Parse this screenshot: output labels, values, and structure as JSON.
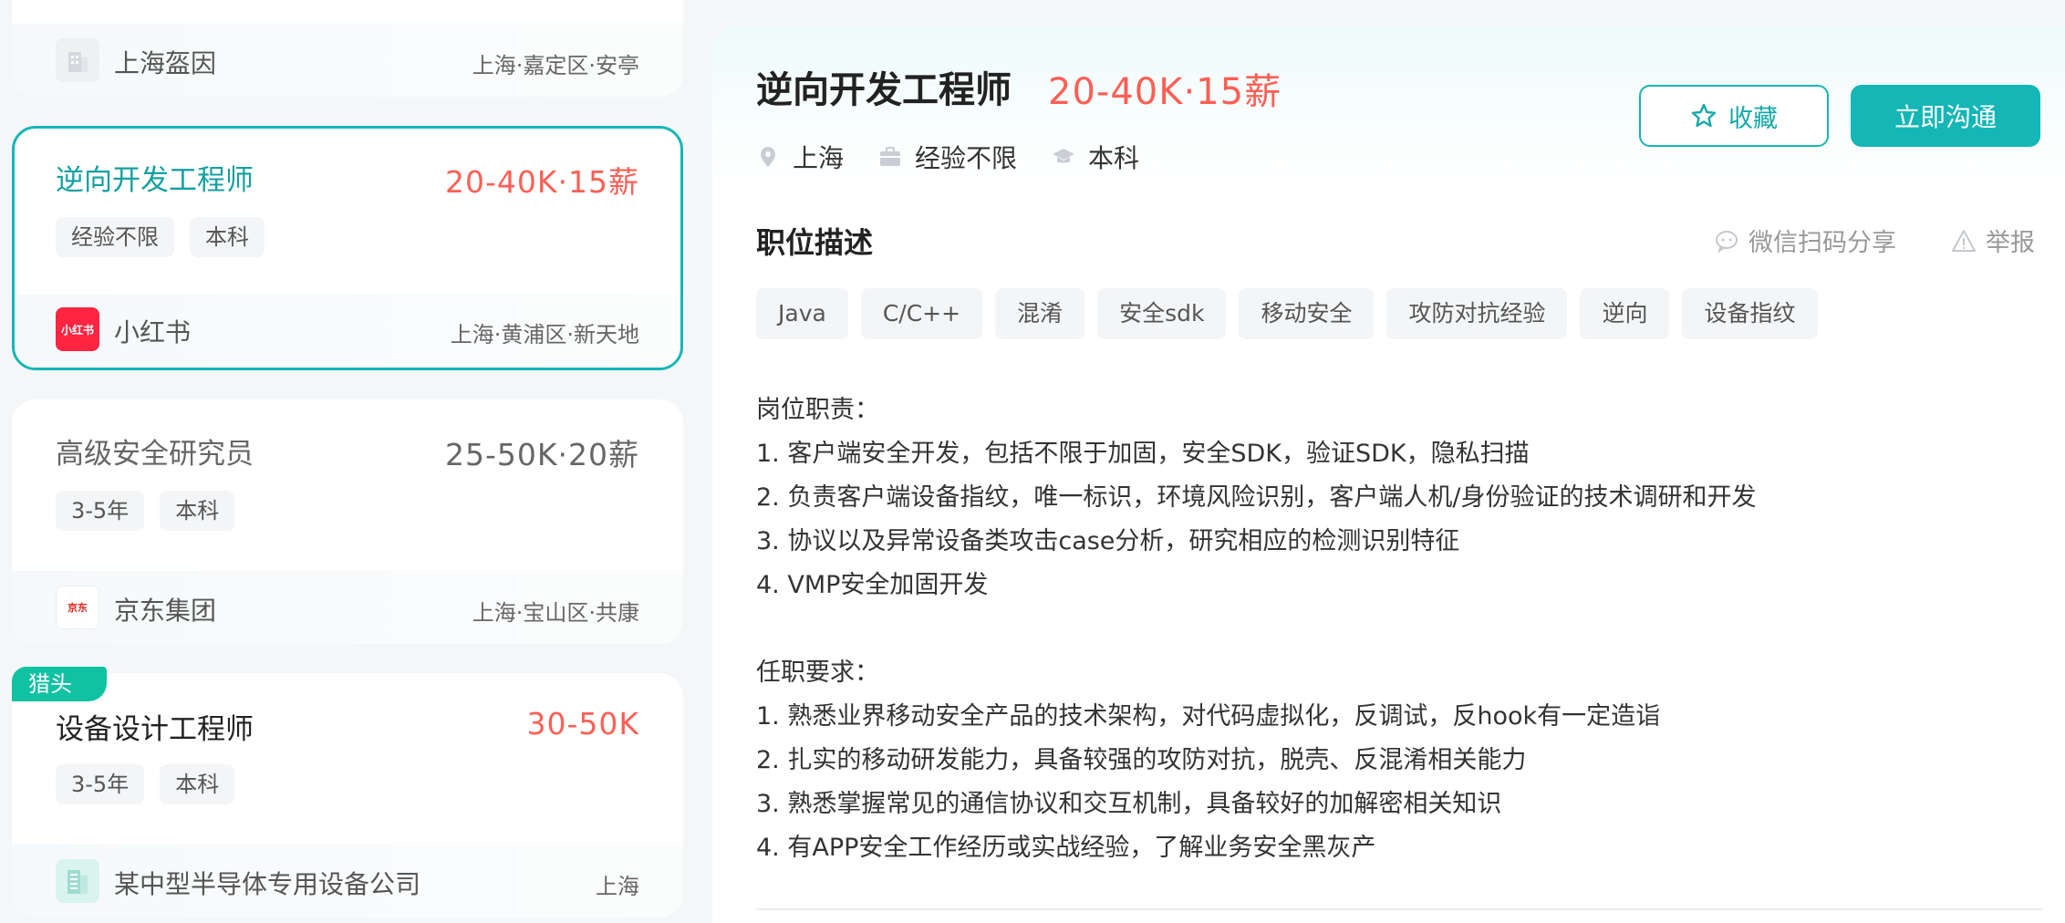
{
  "job_list": {
    "card0": {
      "company": "上海盔因",
      "location": "上海·嘉定区·安亭"
    },
    "card1": {
      "title": "逆向开发工程师",
      "salary": "20-40K·15薪",
      "tags": [
        "经验不限",
        "本科"
      ],
      "company": "小红书",
      "company_logo_text": "小红书",
      "location": "上海·黄浦区·新天地"
    },
    "card2": {
      "title": "高级安全研究员",
      "salary": "25-50K·20薪",
      "tags": [
        "3-5年",
        "本科"
      ],
      "company": "京东集团",
      "company_logo_text": "京东",
      "location": "上海·宝山区·共康"
    },
    "card3": {
      "badge": "猎头",
      "title": "设备设计工程师",
      "salary": "30-50K",
      "tags": [
        "3-5年",
        "本科"
      ],
      "company": "某中型半导体专用设备公司",
      "location": "上海"
    }
  },
  "detail": {
    "title": "逆向开发工程师",
    "salary": "20-40K·15薪",
    "meta": {
      "city": "上海",
      "experience": "经验不限",
      "degree": "本科"
    },
    "fav_label": "收藏",
    "chat_label": "立即沟通",
    "section_title": "职位描述",
    "share_label": "微信扫码分享",
    "report_label": "举报",
    "skills": [
      "Java",
      "C/C++",
      "混淆",
      "安全sdk",
      "移动安全",
      "攻防对抗经验",
      "逆向",
      "设备指纹"
    ],
    "duties_title": "岗位职责：",
    "duties": [
      "1. 客户端安全开发，包括不限于加固，安全SDK，验证SDK，隐私扫描",
      "2. 负责客户端设备指纹，唯一标识，环境风险识别，客户端人机/身份验证的技术调研和开发",
      "3. 协议以及异常设备类攻击case分析，研究相应的检测识别特征",
      "4. VMP安全加固开发"
    ],
    "requirements_title": "任职要求：",
    "requirements": [
      "1. 熟悉业界移动安全产品的技术架构，对代码虚拟化，反调试，反hook有一定造诣",
      "2. 扎实的移动研发能力，具备较强的攻防对抗，脱壳、反混淆相关能力",
      "3. 熟悉掌握常见的通信协议和交互机制，具备较好的加解密相关知识",
      "4. 有APP安全工作经历或实战经验，了解业务安全黑灰产"
    ]
  },
  "colors": {
    "accent": "#14b6b6",
    "salary": "#fd5f55",
    "hunter_badge": "#10c2a2",
    "xhs_red": "#ff2442"
  }
}
